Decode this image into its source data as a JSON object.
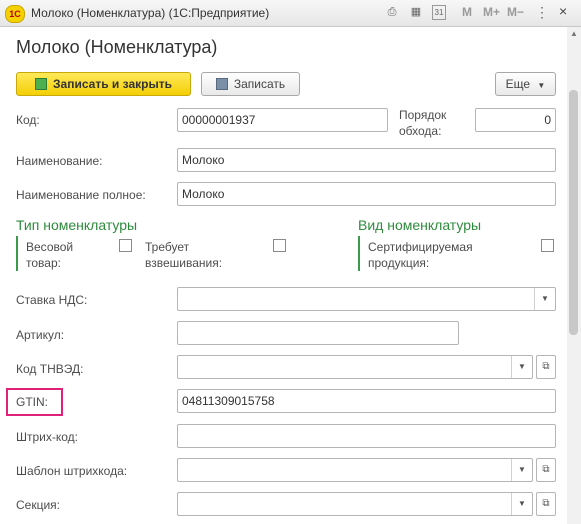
{
  "window": {
    "logo_text": "1С",
    "title": "Молоко (Номенклатура)  (1С:Предприятие)",
    "controls": {
      "m": "M",
      "m_plus": "M+",
      "m_minus": "M−",
      "calendar_day": "31",
      "close": "×"
    }
  },
  "form": {
    "title": "Молоко (Номенклатура)",
    "toolbar": {
      "save_close": "Записать и закрыть",
      "save": "Записать",
      "more": "Еще"
    }
  },
  "fields": {
    "code": {
      "label": "Код:",
      "value": "00000001937"
    },
    "order": {
      "label_line1": "Порядок",
      "label_line2": "обхода:",
      "value": "0"
    },
    "name": {
      "label": "Наименование:",
      "value": "Молоко"
    },
    "full_name": {
      "label": "Наименование полное:",
      "value": "Молоко"
    },
    "vat": {
      "label": "Ставка НДС:",
      "value": ""
    },
    "article": {
      "label": "Артикул:",
      "value": ""
    },
    "tnved": {
      "label": "Код ТНВЭД:",
      "value": ""
    },
    "gtin": {
      "label": "GTIN:",
      "value": "04811309015758"
    },
    "barcode": {
      "label": "Штрих-код:",
      "value": ""
    },
    "barcode_template": {
      "label": "Шаблон штрихкода:",
      "value": ""
    },
    "section": {
      "label": "Секция:",
      "value": ""
    }
  },
  "groups": {
    "type": {
      "title": "Тип номенклатуры",
      "weight_line1": "Весовой",
      "weight_line2": "товар:",
      "weight_checked": false,
      "needs_weigh_line1": "Требует",
      "needs_weigh_line2": "взвешивания:",
      "needs_weigh_checked": false
    },
    "kind": {
      "title": "Вид номенклатуры",
      "certified_line1": "Сертифицируемая",
      "certified_line2": "продукция:",
      "certified_checked": false
    }
  },
  "colors": {
    "primary_button": "#f3cf05",
    "group_title": "#2e8b3c",
    "highlight": "#e0217a"
  }
}
